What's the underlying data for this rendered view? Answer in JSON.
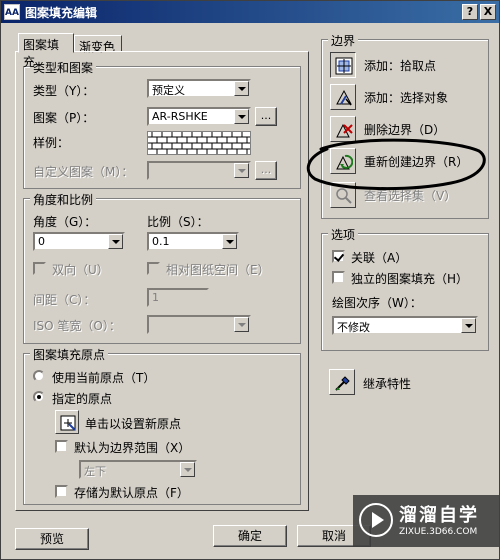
{
  "window": {
    "app_icon": "AA",
    "title": "图案填充编辑",
    "help_label": "?",
    "close_label": "X"
  },
  "tabs": [
    {
      "label": "图案填充",
      "active": true
    },
    {
      "label": "渐变色",
      "active": false
    }
  ],
  "type_pattern": {
    "group_label": "类型和图案",
    "type_label": "类型（Y）：",
    "type_value": "预定义",
    "pattern_label": "图案（P）：",
    "pattern_value": "AR-RSHKE",
    "pattern_ellipsis": "...",
    "swatch_label": "样例：",
    "custom_label": "自定义图案（M）：",
    "custom_value": "",
    "custom_ellipsis": "..."
  },
  "angle_scale": {
    "group_label": "角度和比例",
    "angle_label": "角度（G）：",
    "angle_value": "0",
    "scale_label": "比例（S）：",
    "scale_value": "0.1",
    "double_label": "双向（U）",
    "relative_label": "相对图纸空间（E）",
    "spacing_label": "间距（C）：",
    "spacing_value": "1",
    "iso_label": "ISO 笔宽（O）：",
    "iso_value": ""
  },
  "origin": {
    "group_label": "图案填充原点",
    "use_current_label": "使用当前原点（T）",
    "specified_label": "指定的原点",
    "click_set_label": "单击以设置新原点",
    "default_extent_label": "默认为边界范围（X）",
    "extent_value": "左下",
    "store_default_label": "存储为默认原点（F）"
  },
  "boundaries": {
    "group_label": "边界",
    "add_pick_label": "添加：拾取点",
    "add_select_label": "添加：选择对象",
    "remove_label": "删除边界（D）",
    "recreate_label": "重新创建边界（R）",
    "view_sel_label": "查看选择集（V）"
  },
  "options": {
    "group_label": "选项",
    "assoc_label": "关联（A）",
    "assoc_checked": true,
    "separate_label": "独立的图案填充（H）",
    "separate_checked": false,
    "draw_order_label": "绘图次序（W）：",
    "draw_order_value": "不修改"
  },
  "inherit_label": "继承特性",
  "footer": {
    "preview_label": "预览",
    "ok_label": "确定",
    "cancel_label": "取消"
  },
  "watermark": {
    "title": "溜溜自学",
    "subtitle": "ZIXUE.3D66.COM"
  },
  "colors": {
    "title_start": "#0a246a",
    "title_end": "#3a6ea5",
    "face": "#d4d0c8",
    "annotation_ink": "#000000"
  }
}
